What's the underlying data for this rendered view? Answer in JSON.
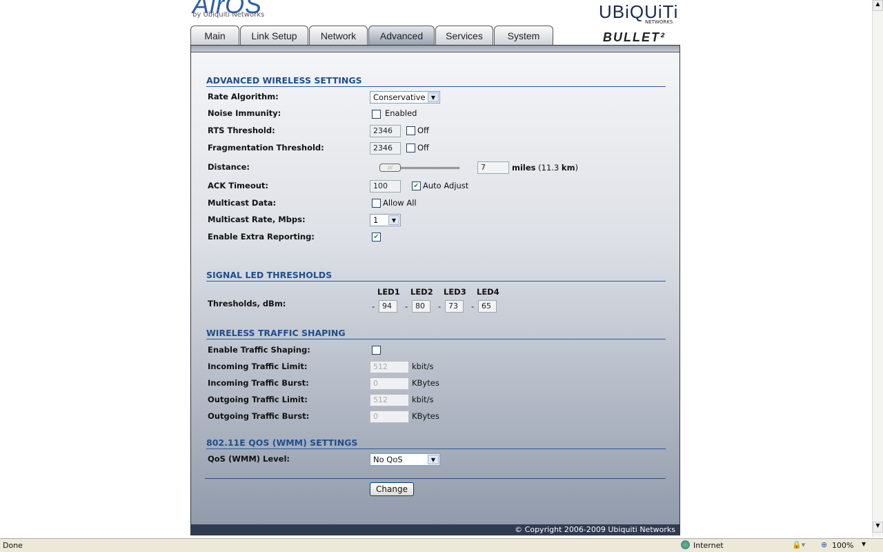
{
  "brand": {
    "logo": "AirOS",
    "by": "by Ubiquiti Networks",
    "vendor": "UBiQUiTi",
    "vendor_sub": "NETWORKS",
    "product": "BULLET²"
  },
  "tabs": [
    "Main",
    "Link Setup",
    "Network",
    "Advanced",
    "Services",
    "System"
  ],
  "active_tab": "Advanced",
  "advanced": {
    "title": "ADVANCED WIRELESS SETTINGS",
    "rate_algorithm": {
      "label": "Rate Algorithm:",
      "value": "Conservative"
    },
    "noise_immunity": {
      "label": "Noise Immunity:",
      "option": "Enabled",
      "checked": false
    },
    "rts": {
      "label": "RTS Threshold:",
      "value": "2346",
      "off": "Off"
    },
    "frag": {
      "label": "Fragmentation Threshold:",
      "value": "2346",
      "off": "Off"
    },
    "distance": {
      "label": "Distance:",
      "value": "7",
      "unit": "miles",
      "km_open": "(11.3 ",
      "km": "km",
      ")": ")",
      "slider_fraction": 0.07
    },
    "ack": {
      "label": "ACK Timeout:",
      "value": "100",
      "auto": "Auto Adjust",
      "checked": true
    },
    "multicast": {
      "label": "Multicast Data:",
      "option": "Allow All",
      "checked": false
    },
    "mrate": {
      "label": "Multicast Rate, Mbps:",
      "value": "1"
    },
    "extra": {
      "label": "Enable Extra Reporting:",
      "checked": true
    }
  },
  "led": {
    "title": "SIGNAL LED THRESHOLDS",
    "label": "Thresholds, dBm:",
    "headers": [
      "LED1",
      "LED2",
      "LED3",
      "LED4"
    ],
    "values": [
      "94",
      "80",
      "73",
      "65"
    ],
    "sign": "-"
  },
  "shaping": {
    "title": "WIRELESS TRAFFIC SHAPING",
    "enable": "Enable Traffic Shaping:",
    "rows": [
      {
        "label": "Incoming Traffic Limit:",
        "value": "512",
        "unit": "kbit/s"
      },
      {
        "label": "Incoming Traffic Burst:",
        "value": "0",
        "unit": "KBytes"
      },
      {
        "label": "Outgoing Traffic Limit:",
        "value": "512",
        "unit": "kbit/s"
      },
      {
        "label": "Outgoing Traffic Burst:",
        "value": "0",
        "unit": "KBytes"
      }
    ]
  },
  "qos": {
    "title": "802.11E QOS (WMM) SETTINGS",
    "label": "QoS (WMM) Level:",
    "value": "No QoS"
  },
  "change": "Change",
  "footer": "© Copyright 2006-2009 Ubiquiti Networks",
  "status": {
    "left": "Done",
    "zone": "Internet",
    "zoom": "100%"
  }
}
